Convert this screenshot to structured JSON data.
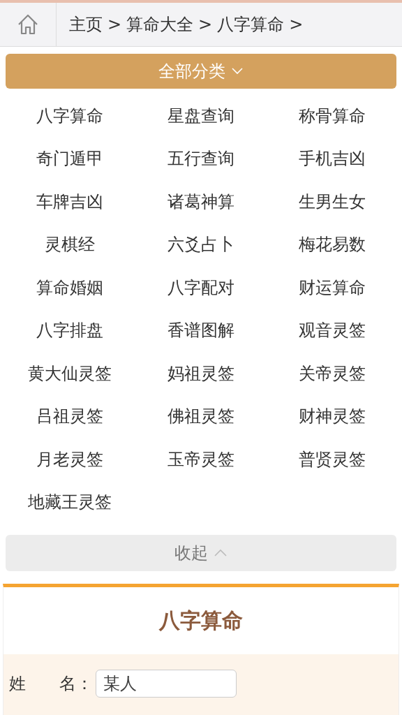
{
  "breadcrumb": [
    {
      "text": "主页",
      "separator": ">"
    },
    {
      "text": "算命大全",
      "separator": ">"
    },
    {
      "text": "八字算命",
      "separator": ">"
    }
  ],
  "category_toggle": {
    "label": "全部分类",
    "expanded": true
  },
  "categories": [
    "八字算命",
    "星盘查询",
    "称骨算命",
    "奇门遁甲",
    "五行查询",
    "手机吉凶",
    "车牌吉凶",
    "诸葛神算",
    "生男生女",
    "灵棋经",
    "六爻占卜",
    "梅花易数",
    "算命婚姻",
    "八字配对",
    "财运算命",
    "八字排盘",
    "香谱图解",
    "观音灵签",
    "黄大仙灵签",
    "妈祖灵签",
    "关帝灵签",
    "吕祖灵签",
    "佛祖灵签",
    "财神灵签",
    "月老灵签",
    "玉帝灵签",
    "普贤灵签",
    "地藏王灵签"
  ],
  "collapse_button": {
    "label": "收起"
  },
  "form": {
    "title": "八字算命",
    "fields": [
      {
        "label": "姓　　名：",
        "value": "某人"
      }
    ]
  }
}
